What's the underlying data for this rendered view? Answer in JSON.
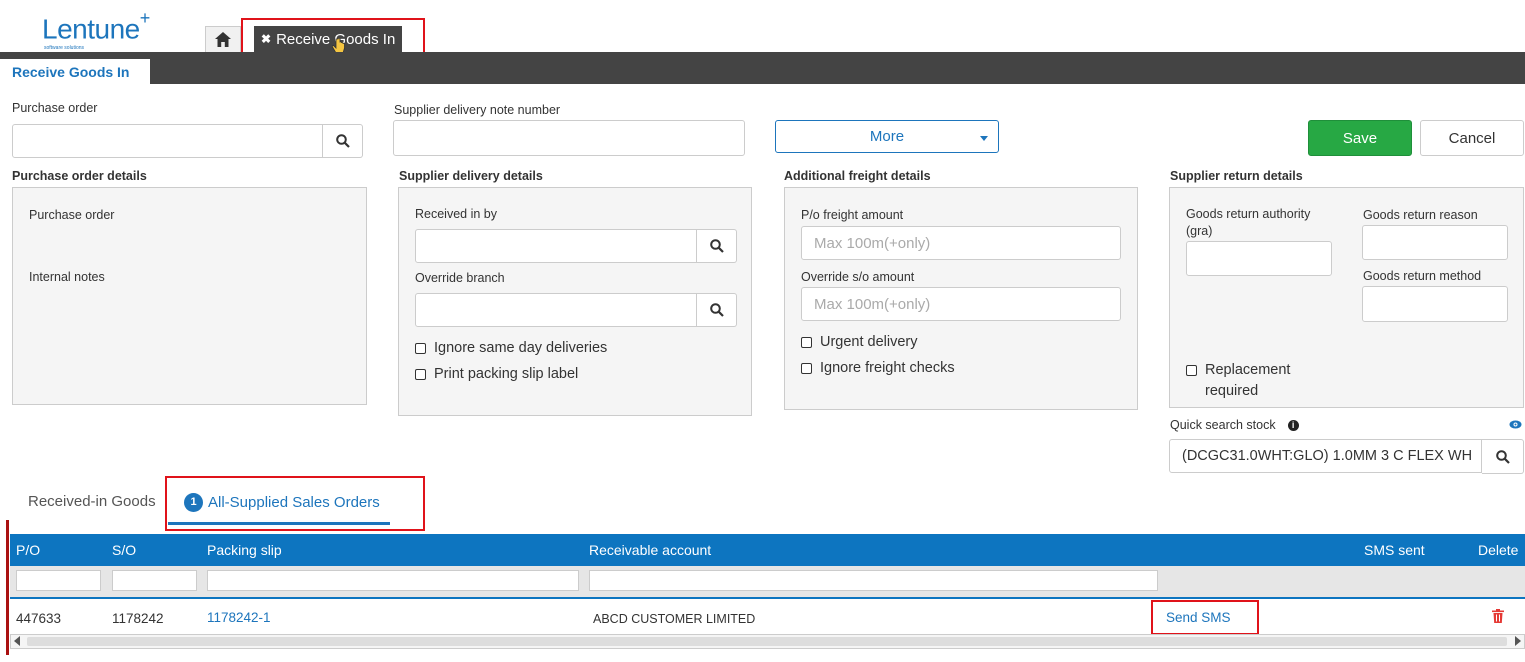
{
  "app": {
    "logo_text": "Lentune",
    "logo_plus": "+",
    "logo_sub": "software solutions"
  },
  "tabs": {
    "home_icon": "home-icon",
    "active_doc_label": "Receive Goods In",
    "page_tab_label": "Receive Goods In"
  },
  "form": {
    "purchase_order_label": "Purchase order",
    "supplier_delivery_note_label": "Supplier delivery note number",
    "more_label": "More",
    "save_label": "Save",
    "cancel_label": "Cancel"
  },
  "po_details": {
    "title": "Purchase order details",
    "purchase_order_label": "Purchase order",
    "internal_notes_label": "Internal notes"
  },
  "supplier_delivery": {
    "title": "Supplier delivery details",
    "received_in_by_label": "Received in by",
    "override_branch_label": "Override branch",
    "ignore_same_day_label": "Ignore same day deliveries",
    "print_packing_slip_label": "Print packing slip label"
  },
  "freight": {
    "title": "Additional freight details",
    "po_freight_label": "P/o freight amount",
    "po_freight_placeholder": "Max 100m(+only)",
    "override_so_label": "Override s/o amount",
    "override_so_placeholder": "Max 100m(+only)",
    "urgent_label": "Urgent delivery",
    "ignore_freight_label": "Ignore freight checks"
  },
  "supplier_return": {
    "title": "Supplier return details",
    "gra_label": "Goods return authority (gra)",
    "reason_label": "Goods return reason",
    "method_label": "Goods return method",
    "replacement_label": "Replacement required"
  },
  "quick_search": {
    "label": "Quick search stock",
    "value": "(DCGC31.0WHT:GLO) 1.0MM 3 C FLEX WH"
  },
  "lower_tabs": {
    "received_label": "Received-in Goods",
    "all_supplied_label": "All-Supplied Sales Orders",
    "all_supplied_count": "1"
  },
  "table": {
    "headers": {
      "po": "P/O",
      "so": "S/O",
      "packing_slip": "Packing slip",
      "receivable_account": "Receivable account",
      "sms_sent": "SMS sent",
      "delete": "Delete"
    },
    "rows": [
      {
        "po": "447633",
        "so": "1178242",
        "packing_slip": "1178242-1",
        "receivable_account": "ABCD CUSTOMER LIMITED",
        "sms_action": "Send SMS"
      }
    ]
  },
  "colors": {
    "brand_blue": "#1d75bc",
    "table_header": "#0d75c0",
    "save_green": "#27a844",
    "highlight_red": "#e0131a",
    "dark_bar": "#444444"
  }
}
